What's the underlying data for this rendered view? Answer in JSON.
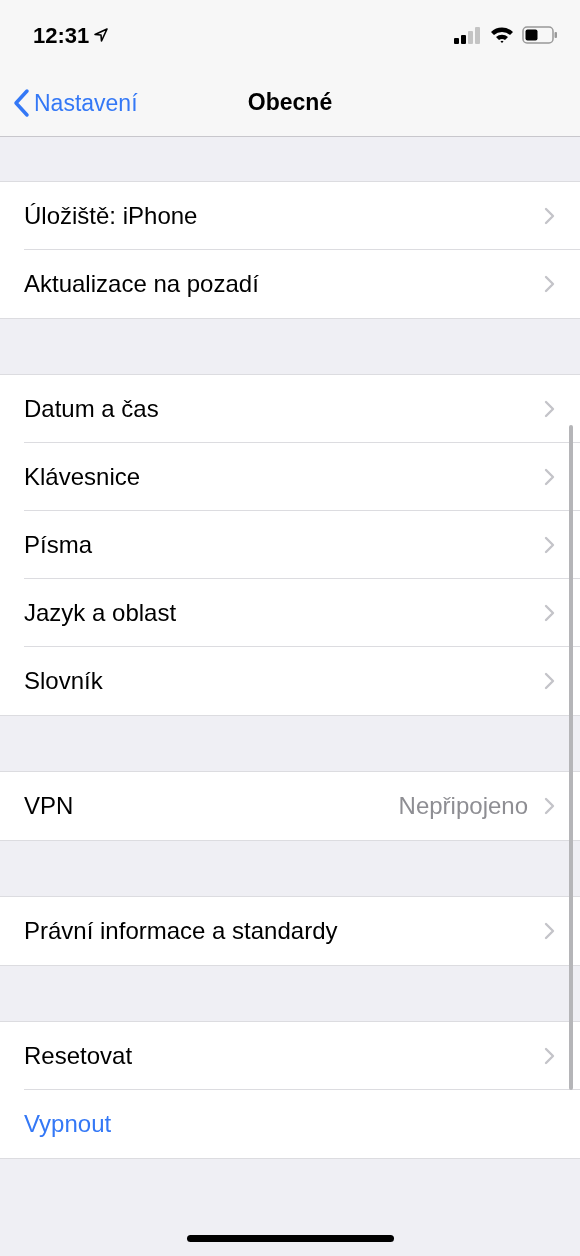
{
  "status_bar": {
    "time": "12:31"
  },
  "nav_bar": {
    "back_label": "Nastavení",
    "title": "Obecné"
  },
  "groups": [
    {
      "rows": [
        {
          "kind": "link",
          "label": "Úložiště: iPhone"
        },
        {
          "kind": "link",
          "label": "Aktualizace na pozadí"
        }
      ]
    },
    {
      "rows": [
        {
          "kind": "link",
          "label": "Datum a čas"
        },
        {
          "kind": "link",
          "label": "Klávesnice"
        },
        {
          "kind": "link",
          "label": "Písma"
        },
        {
          "kind": "link",
          "label": "Jazyk a oblast"
        },
        {
          "kind": "link",
          "label": "Slovník"
        }
      ]
    },
    {
      "rows": [
        {
          "kind": "link",
          "label": "VPN",
          "value": "Nepřipojeno"
        }
      ]
    },
    {
      "rows": [
        {
          "kind": "link",
          "label": "Právní informace a standardy"
        }
      ]
    },
    {
      "rows": [
        {
          "kind": "link",
          "label": "Resetovat"
        },
        {
          "kind": "action",
          "label": "Vypnout"
        }
      ]
    }
  ]
}
